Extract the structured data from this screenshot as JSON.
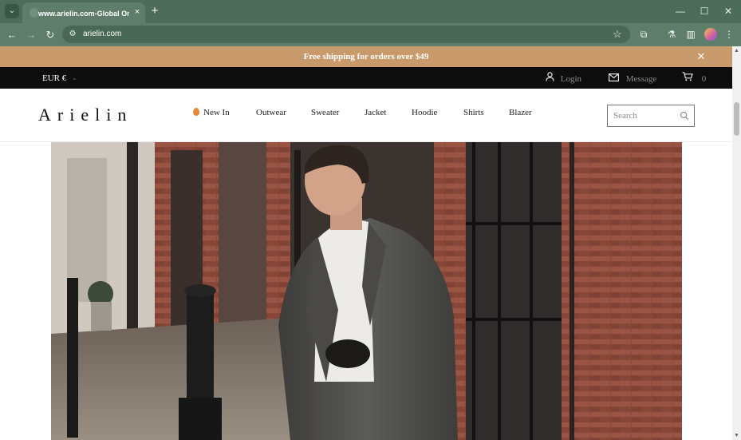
{
  "browser": {
    "tab_title": "www.arielin.com-Global Online",
    "tab_close": "×",
    "new_tab": "+",
    "url": "arielin.com",
    "window_controls": {
      "minimize": "—",
      "maximize": "☐",
      "close": "✕"
    }
  },
  "promo": {
    "text": "Free shipping for orders over $49",
    "close": "✕"
  },
  "utility": {
    "currency": "EUR €",
    "login": "Login",
    "message": "Message",
    "cart_count": "0"
  },
  "header": {
    "logo": "Arielin",
    "nav": [
      "New In",
      "Outwear",
      "Sweater",
      "Jacket",
      "Hoodie",
      "Shirts",
      "Blazer"
    ],
    "search_placeholder": "Search"
  },
  "hero": {
    "colors": {
      "brick": "#8c4a3b",
      "coat": "#4f4e4c",
      "turtleneck": "#ecebe7",
      "pavement": "#8a8073"
    }
  },
  "icons": [
    "tab-menu-icon",
    "reload-icon",
    "back-icon",
    "forward-icon",
    "site-info-icon",
    "star-icon",
    "extensions-icon",
    "labs-icon",
    "side-panel-icon",
    "profile-avatar",
    "kebab-menu-icon",
    "user-icon",
    "mail-icon",
    "cart-icon",
    "flame-icon",
    "search-icon",
    "close-icon"
  ]
}
